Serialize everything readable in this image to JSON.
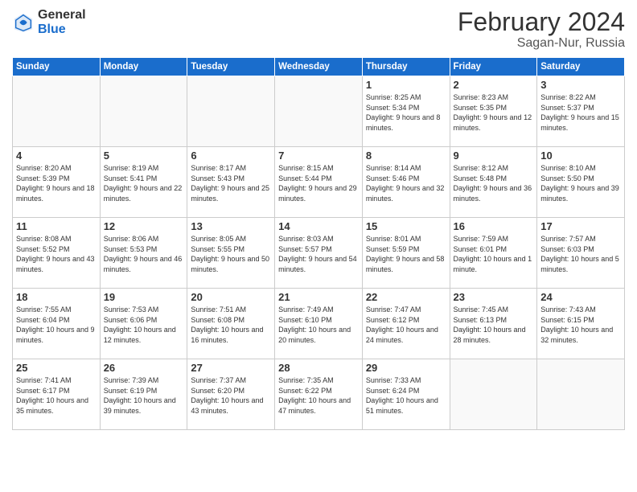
{
  "header": {
    "logo_general": "General",
    "logo_blue": "Blue",
    "title": "February 2024",
    "location": "Sagan-Nur, Russia"
  },
  "days_of_week": [
    "Sunday",
    "Monday",
    "Tuesday",
    "Wednesday",
    "Thursday",
    "Friday",
    "Saturday"
  ],
  "weeks": [
    [
      null,
      null,
      null,
      null,
      {
        "day": "1",
        "sunrise": "8:25 AM",
        "sunset": "5:34 PM",
        "daylight": "9 hours and 8 minutes."
      },
      {
        "day": "2",
        "sunrise": "8:23 AM",
        "sunset": "5:35 PM",
        "daylight": "9 hours and 12 minutes."
      },
      {
        "day": "3",
        "sunrise": "8:22 AM",
        "sunset": "5:37 PM",
        "daylight": "9 hours and 15 minutes."
      }
    ],
    [
      {
        "day": "4",
        "sunrise": "8:20 AM",
        "sunset": "5:39 PM",
        "daylight": "9 hours and 18 minutes."
      },
      {
        "day": "5",
        "sunrise": "8:19 AM",
        "sunset": "5:41 PM",
        "daylight": "9 hours and 22 minutes."
      },
      {
        "day": "6",
        "sunrise": "8:17 AM",
        "sunset": "5:43 PM",
        "daylight": "9 hours and 25 minutes."
      },
      {
        "day": "7",
        "sunrise": "8:15 AM",
        "sunset": "5:44 PM",
        "daylight": "9 hours and 29 minutes."
      },
      {
        "day": "8",
        "sunrise": "8:14 AM",
        "sunset": "5:46 PM",
        "daylight": "9 hours and 32 minutes."
      },
      {
        "day": "9",
        "sunrise": "8:12 AM",
        "sunset": "5:48 PM",
        "daylight": "9 hours and 36 minutes."
      },
      {
        "day": "10",
        "sunrise": "8:10 AM",
        "sunset": "5:50 PM",
        "daylight": "9 hours and 39 minutes."
      }
    ],
    [
      {
        "day": "11",
        "sunrise": "8:08 AM",
        "sunset": "5:52 PM",
        "daylight": "9 hours and 43 minutes."
      },
      {
        "day": "12",
        "sunrise": "8:06 AM",
        "sunset": "5:53 PM",
        "daylight": "9 hours and 46 minutes."
      },
      {
        "day": "13",
        "sunrise": "8:05 AM",
        "sunset": "5:55 PM",
        "daylight": "9 hours and 50 minutes."
      },
      {
        "day": "14",
        "sunrise": "8:03 AM",
        "sunset": "5:57 PM",
        "daylight": "9 hours and 54 minutes."
      },
      {
        "day": "15",
        "sunrise": "8:01 AM",
        "sunset": "5:59 PM",
        "daylight": "9 hours and 58 minutes."
      },
      {
        "day": "16",
        "sunrise": "7:59 AM",
        "sunset": "6:01 PM",
        "daylight": "10 hours and 1 minute."
      },
      {
        "day": "17",
        "sunrise": "7:57 AM",
        "sunset": "6:03 PM",
        "daylight": "10 hours and 5 minutes."
      }
    ],
    [
      {
        "day": "18",
        "sunrise": "7:55 AM",
        "sunset": "6:04 PM",
        "daylight": "10 hours and 9 minutes."
      },
      {
        "day": "19",
        "sunrise": "7:53 AM",
        "sunset": "6:06 PM",
        "daylight": "10 hours and 12 minutes."
      },
      {
        "day": "20",
        "sunrise": "7:51 AM",
        "sunset": "6:08 PM",
        "daylight": "10 hours and 16 minutes."
      },
      {
        "day": "21",
        "sunrise": "7:49 AM",
        "sunset": "6:10 PM",
        "daylight": "10 hours and 20 minutes."
      },
      {
        "day": "22",
        "sunrise": "7:47 AM",
        "sunset": "6:12 PM",
        "daylight": "10 hours and 24 minutes."
      },
      {
        "day": "23",
        "sunrise": "7:45 AM",
        "sunset": "6:13 PM",
        "daylight": "10 hours and 28 minutes."
      },
      {
        "day": "24",
        "sunrise": "7:43 AM",
        "sunset": "6:15 PM",
        "daylight": "10 hours and 32 minutes."
      }
    ],
    [
      {
        "day": "25",
        "sunrise": "7:41 AM",
        "sunset": "6:17 PM",
        "daylight": "10 hours and 35 minutes."
      },
      {
        "day": "26",
        "sunrise": "7:39 AM",
        "sunset": "6:19 PM",
        "daylight": "10 hours and 39 minutes."
      },
      {
        "day": "27",
        "sunrise": "7:37 AM",
        "sunset": "6:20 PM",
        "daylight": "10 hours and 43 minutes."
      },
      {
        "day": "28",
        "sunrise": "7:35 AM",
        "sunset": "6:22 PM",
        "daylight": "10 hours and 47 minutes."
      },
      {
        "day": "29",
        "sunrise": "7:33 AM",
        "sunset": "6:24 PM",
        "daylight": "10 hours and 51 minutes."
      },
      null,
      null
    ]
  ]
}
